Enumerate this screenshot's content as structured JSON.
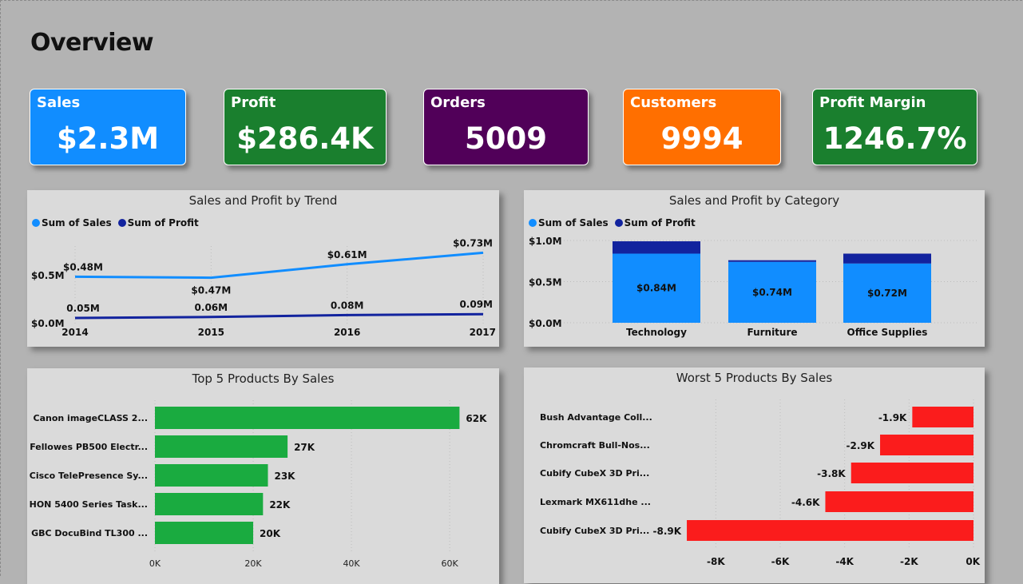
{
  "page_title": "Overview",
  "kpis": [
    {
      "label": "Sales",
      "value": "$2.3M",
      "color": "#118dff"
    },
    {
      "label": "Profit",
      "value": "$286.4K",
      "color": "#1a7f2e"
    },
    {
      "label": "Orders",
      "value": "5009",
      "color": "#510059"
    },
    {
      "label": "Customers",
      "value": "9994",
      "color": "#ff6f00"
    },
    {
      "label": "Profit Margin",
      "value": "1246.7%",
      "color": "#1a7f2e"
    }
  ],
  "colors": {
    "sales": "#118dff",
    "profit": "#12239e",
    "top_bar": "#1aab40",
    "worst_bar": "#fb1c1c"
  },
  "legend": {
    "sales": "Sum of Sales",
    "profit": "Sum of Profit"
  },
  "chart_data": [
    {
      "type": "line",
      "title": "Sales and Profit by Trend",
      "x": [
        "2014",
        "2015",
        "2016",
        "2017"
      ],
      "series": [
        {
          "name": "Sum of Sales",
          "values": [
            0.48,
            0.47,
            0.61,
            0.73
          ],
          "labels": [
            "$0.48M",
            "$0.47M",
            "$0.61M",
            "$0.73M"
          ]
        },
        {
          "name": "Sum of Profit",
          "values": [
            0.05,
            0.06,
            0.08,
            0.09
          ],
          "labels": [
            "0.05M",
            "0.06M",
            "0.08M",
            "0.09M"
          ]
        }
      ],
      "yticks": [
        "$0.0M",
        "$0.5M"
      ],
      "ylim": [
        0,
        0.8
      ]
    },
    {
      "type": "bar",
      "stacked": true,
      "title": "Sales and Profit by Category",
      "categories": [
        "Technology",
        "Furniture",
        "Office Supplies"
      ],
      "series": [
        {
          "name": "Sum of Sales",
          "values": [
            0.84,
            0.74,
            0.72
          ],
          "labels": [
            "$0.84M",
            "$0.74M",
            "$0.72M"
          ]
        },
        {
          "name": "Sum of Profit",
          "values": [
            0.15,
            0.02,
            0.12
          ]
        }
      ],
      "yticks": [
        "$0.0M",
        "$0.5M",
        "$1.0M"
      ],
      "ylim": [
        0,
        1.0
      ]
    },
    {
      "type": "bar",
      "orientation": "horizontal",
      "title": "Top 5 Products By Sales",
      "categories": [
        "Canon imageCLASS 2...",
        "Fellowes PB500 Electr...",
        "Cisco TelePresence Sy...",
        "HON 5400 Series Task...",
        "GBC DocuBind TL300 ..."
      ],
      "values": [
        62,
        27,
        23,
        22,
        20
      ],
      "labels": [
        "62K",
        "27K",
        "23K",
        "22K",
        "20K"
      ],
      "xticks": [
        "0K",
        "20K",
        "40K",
        "60K"
      ],
      "xlim": [
        0,
        66
      ]
    },
    {
      "type": "bar",
      "orientation": "horizontal",
      "title": "Worst 5 Products By Sales",
      "categories": [
        "Bush Advantage Coll...",
        "Chromcraft Bull-Nos...",
        "Cubify CubeX 3D Pri...",
        "Lexmark MX611dhe ...",
        "Cubify CubeX 3D Pri..."
      ],
      "values": [
        -1.9,
        -2.9,
        -3.8,
        -4.6,
        -8.9
      ],
      "labels": [
        "-1.9K",
        "-2.9K",
        "-3.8K",
        "-4.6K",
        "-8.9K"
      ],
      "xticks": [
        "-8K",
        "-6K",
        "-4K",
        "-2K",
        "0K"
      ],
      "xlim": [
        -9.0,
        0
      ]
    }
  ]
}
